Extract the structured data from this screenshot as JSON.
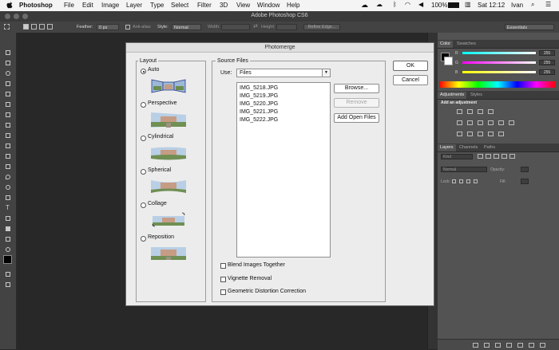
{
  "menubar": {
    "app": "Photoshop",
    "items": [
      "File",
      "Edit",
      "Image",
      "Layer",
      "Type",
      "Select",
      "Filter",
      "3D",
      "View",
      "Window",
      "Help"
    ],
    "battery": "100%",
    "clock": "Sat 12:12",
    "user": "Ivan"
  },
  "titlebar": {
    "title": "Adobe Photoshop CS6"
  },
  "options": {
    "feather_label": "Feather:",
    "feather_value": "0 px",
    "antialias_label": "Anti-alias",
    "style_label": "Style:",
    "style_value": "Normal",
    "width_label": "Width:",
    "height_label": "Height:",
    "refine_label": "Refine Edge...",
    "workspace": "Essentials"
  },
  "panels": {
    "color_tabs": [
      "Color",
      "Swatches"
    ],
    "channels": [
      {
        "label": "R",
        "value": "255"
      },
      {
        "label": "G",
        "value": "255"
      },
      {
        "label": "B",
        "value": "255"
      }
    ],
    "adjust_tabs": [
      "Adjustments",
      "Styles"
    ],
    "add_adjustment": "Add an adjustment",
    "layers_tabs": [
      "Layers",
      "Channels",
      "Paths"
    ],
    "kind": "Kind",
    "blend": "Normal",
    "opacity_label": "Opacity:",
    "lock_label": "Lock:",
    "fill_label": "Fill:"
  },
  "dialog": {
    "title": "Photomerge",
    "layout_title": "Layout",
    "layouts": [
      {
        "label": "Auto",
        "selected": true
      },
      {
        "label": "Perspective",
        "selected": false
      },
      {
        "label": "Cylindrical",
        "selected": false
      },
      {
        "label": "Spherical",
        "selected": false
      },
      {
        "label": "Collage",
        "selected": false
      },
      {
        "label": "Reposition",
        "selected": false
      }
    ],
    "source_title": "Source Files",
    "use_label": "Use:",
    "use_value": "Files",
    "files": [
      "IMG_5218.JPG",
      "IMG_5219.JPG",
      "IMG_5220.JPG",
      "IMG_5221.JPG",
      "IMG_5222.JPG"
    ],
    "browse_label": "Browse...",
    "remove_label": "Remove",
    "add_open_label": "Add Open Files",
    "ok_label": "OK",
    "cancel_label": "Cancel",
    "options": [
      {
        "label": "Blend Images Together",
        "checked": false
      },
      {
        "label": "Vignette Removal",
        "checked": false
      },
      {
        "label": "Geometric Distortion Correction",
        "checked": false
      }
    ]
  }
}
